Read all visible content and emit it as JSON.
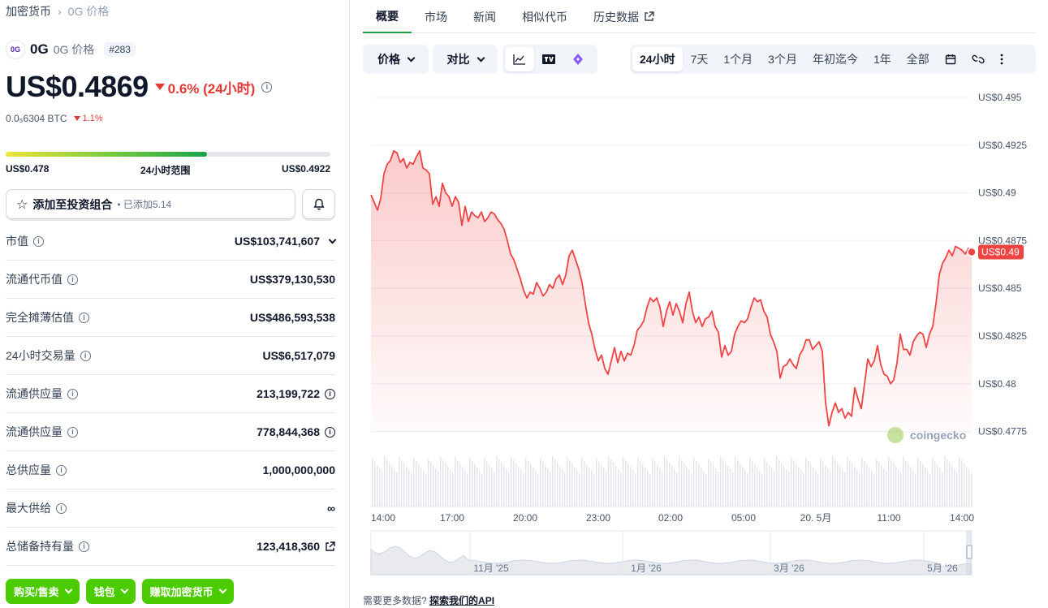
{
  "breadcrumb": {
    "root": "加密货币",
    "current": "0G 价格"
  },
  "coin": {
    "logo_text": "0G",
    "symbol": "0G",
    "name": "0G 价格",
    "rank": "#283"
  },
  "price": {
    "value": "US$0.4869",
    "change": "0.6% (24小时)"
  },
  "btc": {
    "value": "0.0₅6304 BTC",
    "change": "1.1%"
  },
  "range": {
    "low": "US$0.478",
    "label": "24小时范围",
    "high": "US$0.4922",
    "fill_fraction": 0.62
  },
  "portfolio": {
    "add_label": "添加至投资组合",
    "added": "• 已添加5.14"
  },
  "stats": [
    {
      "label": "市值",
      "value": "US$103,741,607",
      "suffix": "chevron"
    },
    {
      "label": "流通代币值",
      "value": "US$379,130,530",
      "suffix": ""
    },
    {
      "label": "完全摊薄估值",
      "value": "US$486,593,538",
      "suffix": ""
    },
    {
      "label": "24小时交易量",
      "value": "US$6,517,079",
      "suffix": ""
    },
    {
      "label": "流通供应量",
      "value": "213,199,722",
      "suffix": "info"
    },
    {
      "label": "流通供应量",
      "value": "778,844,368",
      "suffix": "info"
    },
    {
      "label": "总供应量",
      "value": "1,000,000,000",
      "suffix": ""
    },
    {
      "label": "最大供给",
      "value": "∞",
      "suffix": ""
    },
    {
      "label": "总储备持有量",
      "value": "123,418,360",
      "suffix": "external"
    }
  ],
  "bottom_buttons": [
    "购买/售卖",
    "钱包",
    "赚取加密货币"
  ],
  "tabs": [
    "概要",
    "市场",
    "新闻",
    "相似代币",
    "历史数据"
  ],
  "toolbar": {
    "price_label": "价格",
    "compare_label": "对比",
    "ranges": [
      "24小时",
      "7天",
      "1个月",
      "3个月",
      "年初迄今",
      "1年",
      "全部"
    ],
    "active_range": "24小时"
  },
  "chart": {
    "y_ticks": [
      "US$0.495",
      "US$0.4925",
      "US$0.49",
      "US$0.4875",
      "US$0.485",
      "US$0.4825",
      "US$0.48",
      "US$0.4775"
    ],
    "x_ticks": [
      "14:00",
      "17:00",
      "20:00",
      "23:00",
      "02:00",
      "05:00",
      "20. 5月",
      "11:00",
      "14:00"
    ],
    "nav_ticks": [
      "11月 '25",
      "1月 '26",
      "3月 '26",
      "5月 '26"
    ],
    "current_tag": "US$0.49",
    "watermark": "coingecko",
    "line_color": "#ef4444"
  },
  "footer": {
    "text": "需要更多数据?",
    "link": "探索我们的API"
  }
}
